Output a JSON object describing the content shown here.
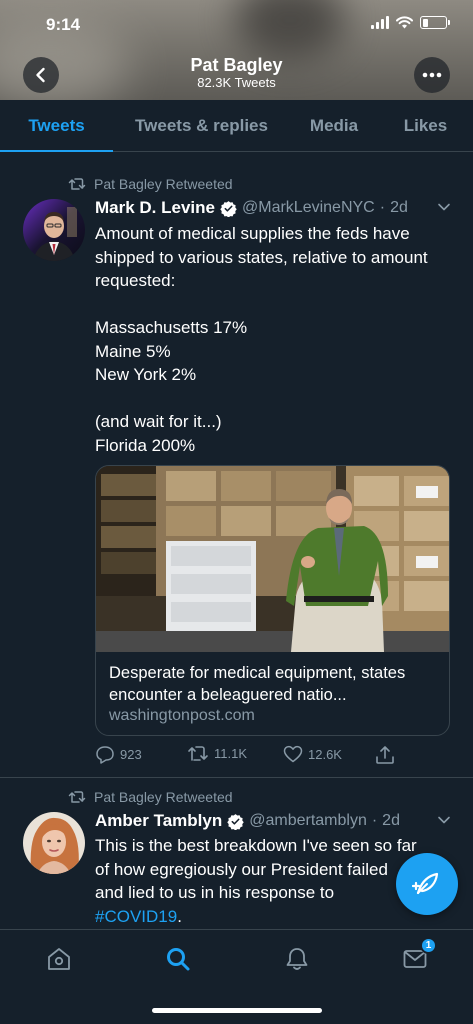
{
  "status_bar": {
    "time": "9:14",
    "battery_level": 0.25
  },
  "header": {
    "title": "Pat Bagley",
    "subtitle": "82.3K Tweets",
    "back_icon": "chevron-left-icon",
    "more_icon": "ellipsis-icon"
  },
  "tabs": [
    {
      "label": "Tweets",
      "active": true
    },
    {
      "label": "Tweets & replies",
      "active": false
    },
    {
      "label": "Media",
      "active": false
    },
    {
      "label": "Likes",
      "active": false
    }
  ],
  "tweets": [
    {
      "retweet_label": "Pat Bagley Retweeted",
      "name": "Mark D. Levine",
      "handle": "@MarkLevineNYC",
      "sep": "·",
      "time": "2d",
      "text": "Amount of medical supplies the feds have shipped to various states, relative to amount requested:\n\nMassachusetts 17%\nMaine 5%\nNew York 2%\n\n(and wait for it...)\nFlorida 200%",
      "card": {
        "title": "Desperate for medical equipment, states encounter a beleaguered natio...",
        "domain": "washingtonpost.com"
      },
      "counts": {
        "replies": "923",
        "retweets": "11.1K",
        "likes": "12.6K"
      }
    },
    {
      "retweet_label": "Pat Bagley Retweeted",
      "name": "Amber Tamblyn",
      "handle": "@ambertamblyn",
      "sep": "·",
      "time": "2d",
      "text_lines": [
        "This is the best breakdown I've seen so far",
        "of how egregiously our President failed",
        "and lied to us in his response to"
      ],
      "hashtag": "#COVID19",
      "hashtag_suffix": "."
    }
  ],
  "bottom_nav": {
    "items": [
      "home-icon",
      "search-icon",
      "notifications-icon",
      "messages-icon"
    ],
    "messages_badge": "1",
    "active": "search-icon"
  },
  "colors": {
    "accent": "#1da1f2",
    "background": "#15202b",
    "muted": "#8899a6",
    "border": "#38444d"
  }
}
